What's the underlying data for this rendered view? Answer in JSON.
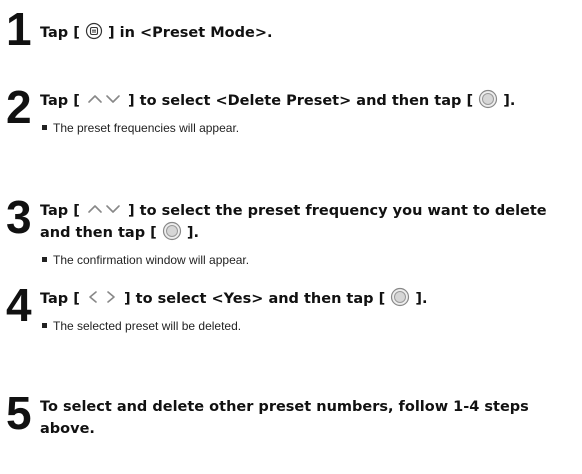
{
  "steps": [
    {
      "number": "1",
      "parts": [
        "Tap [",
        "] in <Preset Mode>."
      ],
      "icons": [
        "menu-icon"
      ]
    },
    {
      "number": "2",
      "parts": [
        "Tap [",
        "] to select <Delete Preset> and then tap [",
        "]."
      ],
      "icons": [
        "up-down-arrows-icon",
        "select-button-icon"
      ],
      "note": "The preset frequencies will appear."
    },
    {
      "number": "3",
      "parts": [
        "Tap [",
        "] to select the preset frequency you want to delete",
        "and then tap [",
        "]."
      ],
      "icons": [
        "up-down-arrows-icon",
        "select-button-icon"
      ],
      "note": "The confirmation window will appear."
    },
    {
      "number": "4",
      "parts": [
        "Tap [",
        "] to select <Yes> and then tap [",
        "]."
      ],
      "icons": [
        "left-right-arrows-icon",
        "select-button-icon"
      ],
      "note": "The selected preset will be deleted."
    },
    {
      "number": "5",
      "parts": [
        "To select and delete other preset numbers, follow 1-4 steps",
        "above."
      ]
    }
  ]
}
